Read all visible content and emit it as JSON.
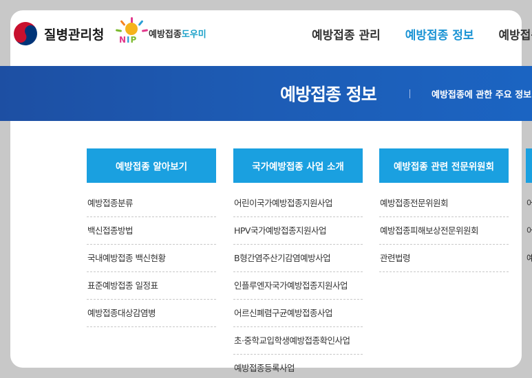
{
  "header": {
    "agency_name": "질병관리청",
    "nip_letters": [
      "N",
      "I",
      "P"
    ],
    "nip_title_main": "예방접종",
    "nip_title_accent": "도우미",
    "nav": [
      {
        "label": "예방접종 관리",
        "active": false
      },
      {
        "label": "예방접종 정보",
        "active": true
      },
      {
        "label": "예방접종",
        "active": false
      }
    ]
  },
  "banner": {
    "title": "예방접종 정보",
    "description": "예방접종에 관한 주요 정보"
  },
  "columns": [
    {
      "title": "예방접종 알아보기",
      "items": [
        "예방접종분류",
        "백신접종방법",
        "국내예방접종 백신현황",
        "표준예방접종 일정표",
        "예방접종대상감염병"
      ]
    },
    {
      "title": "국가예방접종 사업 소개",
      "items": [
        "어린이국가예방접종지원사업",
        "HPV국가예방접종지원사업",
        "B형간염주산기감염예방사업",
        "인플루엔자국가예방접종지원사업",
        "어르신폐렴구균예방접종사업",
        "초·중학교입학생예방접종확인사업",
        "예방접종등록사업"
      ]
    },
    {
      "title": "예방접종 관련 전문위원회",
      "items": [
        "예방접종전문위원회",
        "예방접종피해보상전문위원회",
        "관련법령"
      ]
    },
    {
      "title": "",
      "items": [
        "어",
        "어",
        "예"
      ]
    }
  ],
  "colors": {
    "banner": "#1d5cb5",
    "column_header": "#1aa0e0",
    "nav_active": "#1a93d4"
  }
}
